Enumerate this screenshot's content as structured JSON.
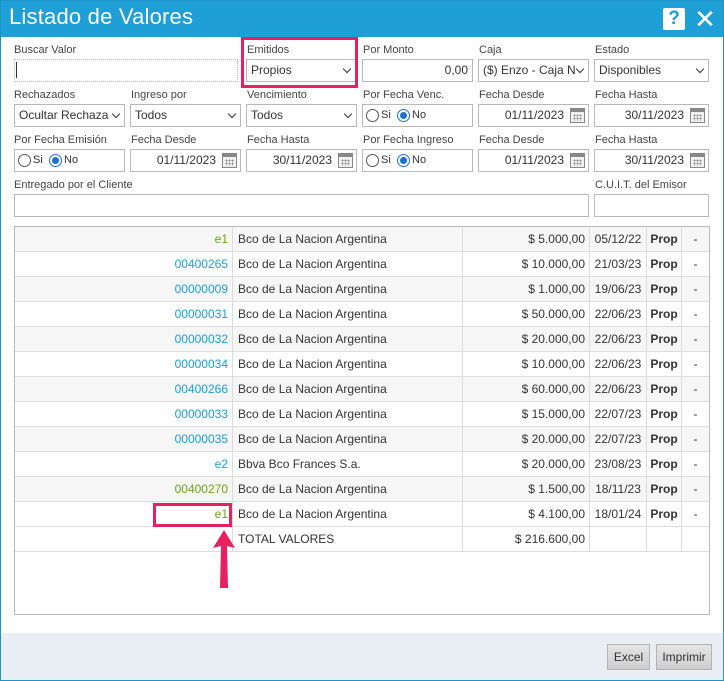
{
  "window": {
    "title": "Listado de Valores",
    "help_icon": "?",
    "close_icon": "✕"
  },
  "filters": {
    "buscar_valor": {
      "label": "Buscar Valor",
      "value": ""
    },
    "emitidos": {
      "label": "Emitidos",
      "value": "Propios"
    },
    "por_monto": {
      "label": "Por Monto",
      "value": "0,00"
    },
    "caja": {
      "label": "Caja",
      "value": "($) Enzo - Caja N"
    },
    "estado": {
      "label": "Estado",
      "value": "Disponibles"
    },
    "rechazados": {
      "label": "Rechazados",
      "value": "Ocultar Rechaza"
    },
    "ingreso_por": {
      "label": "Ingreso por",
      "value": "Todos"
    },
    "vencimiento": {
      "label": "Vencimiento",
      "value": "Todos"
    },
    "por_fecha_venc": {
      "label": "Por Fecha Venc.",
      "si": "Si",
      "no": "No"
    },
    "fecha_desde_1": {
      "label": "Fecha Desde",
      "value": "01/11/2023"
    },
    "fecha_hasta_1": {
      "label": "Fecha Hasta",
      "value": "30/11/2023"
    },
    "por_fecha_emision": {
      "label": "Por Fecha Emisión",
      "si": "Si",
      "no": "No"
    },
    "fecha_desde_2": {
      "label": "Fecha Desde",
      "value": "01/11/2023"
    },
    "fecha_hasta_2": {
      "label": "Fecha Hasta",
      "value": "30/11/2023"
    },
    "por_fecha_ingreso": {
      "label": "Por Fecha Ingreso",
      "si": "Si",
      "no": "No"
    },
    "fecha_desde_3": {
      "label": "Fecha Desde",
      "value": "01/11/2023"
    },
    "fecha_hasta_3": {
      "label": "Fecha Hasta",
      "value": "30/11/2023"
    },
    "entregado_por": {
      "label": "Entregado por el Cliente",
      "value": ""
    },
    "cuit_emisor": {
      "label": "C.U.I.T. del Emisor",
      "value": ""
    }
  },
  "table": {
    "rows": [
      {
        "numero": "e1",
        "color": "green",
        "banco": "Bco de La Nacion Argentina",
        "importe": "$ 5.000,00",
        "fecha": "05/12/22",
        "tipo": "Prop",
        "extra": "-"
      },
      {
        "numero": "00400265",
        "color": "blue",
        "banco": "Bco de La Nacion Argentina",
        "importe": "$ 10.000,00",
        "fecha": "21/03/23",
        "tipo": "Prop",
        "extra": "-"
      },
      {
        "numero": "00000009",
        "color": "blue",
        "banco": "Bco de La Nacion Argentina",
        "importe": "$ 1.000,00",
        "fecha": "19/06/23",
        "tipo": "Prop",
        "extra": "-"
      },
      {
        "numero": "00000031",
        "color": "blue",
        "banco": "Bco de La Nacion Argentina",
        "importe": "$ 50.000,00",
        "fecha": "22/06/23",
        "tipo": "Prop",
        "extra": "-"
      },
      {
        "numero": "00000032",
        "color": "blue",
        "banco": "Bco de La Nacion Argentina",
        "importe": "$ 20.000,00",
        "fecha": "22/06/23",
        "tipo": "Prop",
        "extra": "-"
      },
      {
        "numero": "00000034",
        "color": "blue",
        "banco": "Bco de La Nacion Argentina",
        "importe": "$ 10.000,00",
        "fecha": "22/06/23",
        "tipo": "Prop",
        "extra": "-"
      },
      {
        "numero": "00400266",
        "color": "blue",
        "banco": "Bco de La Nacion Argentina",
        "importe": "$ 60.000,00",
        "fecha": "22/06/23",
        "tipo": "Prop",
        "extra": "-"
      },
      {
        "numero": "00000033",
        "color": "blue",
        "banco": "Bco de La Nacion Argentina",
        "importe": "$ 15.000,00",
        "fecha": "22/07/23",
        "tipo": "Prop",
        "extra": "-"
      },
      {
        "numero": "00000035",
        "color": "blue",
        "banco": "Bco de La Nacion Argentina",
        "importe": "$ 20.000,00",
        "fecha": "22/07/23",
        "tipo": "Prop",
        "extra": "-"
      },
      {
        "numero": "e2",
        "color": "blue",
        "banco": "Bbva Bco Frances S.a.",
        "importe": "$ 20.000,00",
        "fecha": "23/08/23",
        "tipo": "Prop",
        "extra": "-"
      },
      {
        "numero": "00400270",
        "color": "green",
        "banco": "Bco de La Nacion Argentina",
        "importe": "$ 1.500,00",
        "fecha": "18/11/23",
        "tipo": "Prop",
        "extra": "-"
      },
      {
        "numero": "e1",
        "color": "green",
        "banco": "Bco de La Nacion Argentina",
        "importe": "$ 4.100,00",
        "fecha": "18/01/24",
        "tipo": "Prop",
        "extra": "-"
      }
    ],
    "total": {
      "label": "TOTAL VALORES",
      "importe": "$ 216.600,00"
    }
  },
  "buttons": {
    "excel": "Excel",
    "imprimir": "Imprimir"
  },
  "colors": {
    "titlebar": "#1e9fd6",
    "highlight": "#e8205f",
    "link_blue": "#1aa0d6",
    "link_green": "#6aa514"
  }
}
